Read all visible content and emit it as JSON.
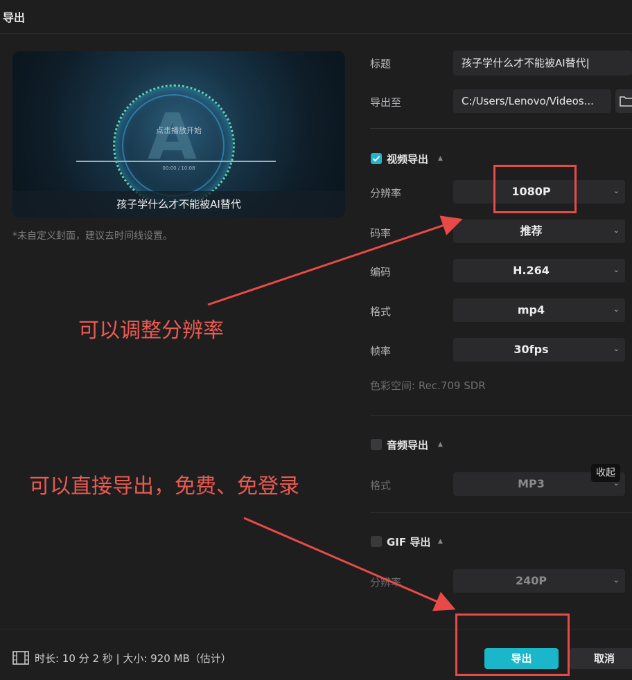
{
  "dialog": {
    "title": "导出"
  },
  "preview": {
    "play_hint": "点击播放开始",
    "time": "00:00 / 10:08",
    "caption": "孩子学什么才不能被AI替代"
  },
  "cover_note": "*未自定义封面，建议去时间线设置。",
  "form": {
    "title_label": "标题",
    "title_value": "孩子学什么才不能被AI替代",
    "export_to_label": "导出至",
    "export_path": "C:/Users/Lenovo/Videos..."
  },
  "video_export": {
    "label": "视频导出",
    "checked": true,
    "resolution_label": "分辨率",
    "resolution": "1080P",
    "bitrate_label": "码率",
    "bitrate": "推荐",
    "codec_label": "编码",
    "codec": "H.264",
    "format_label": "格式",
    "format": "mp4",
    "framerate_label": "帧率",
    "framerate": "30fps",
    "color_space": "色彩空间:   Rec.709 SDR"
  },
  "audio_export": {
    "label": "音频导出",
    "checked": false,
    "format_label": "格式",
    "format": "MP3"
  },
  "gif_export": {
    "label": "GIF 导出",
    "checked": false,
    "resolution_label": "分辨率",
    "resolution": "240P"
  },
  "tooltip": "收起",
  "footer": {
    "info": "时长:  10 分 2 秒 | 大小:  920 MB（估计）",
    "export_label": "导出",
    "cancel_label": "取消"
  },
  "annotations": {
    "resolution_note": "可以调整分辨率",
    "export_note": "可以直接导出，免费、免登录"
  },
  "colors": {
    "accent": "#19b7c9",
    "annotation": "#e84a48",
    "background": "#1e1e1f"
  }
}
